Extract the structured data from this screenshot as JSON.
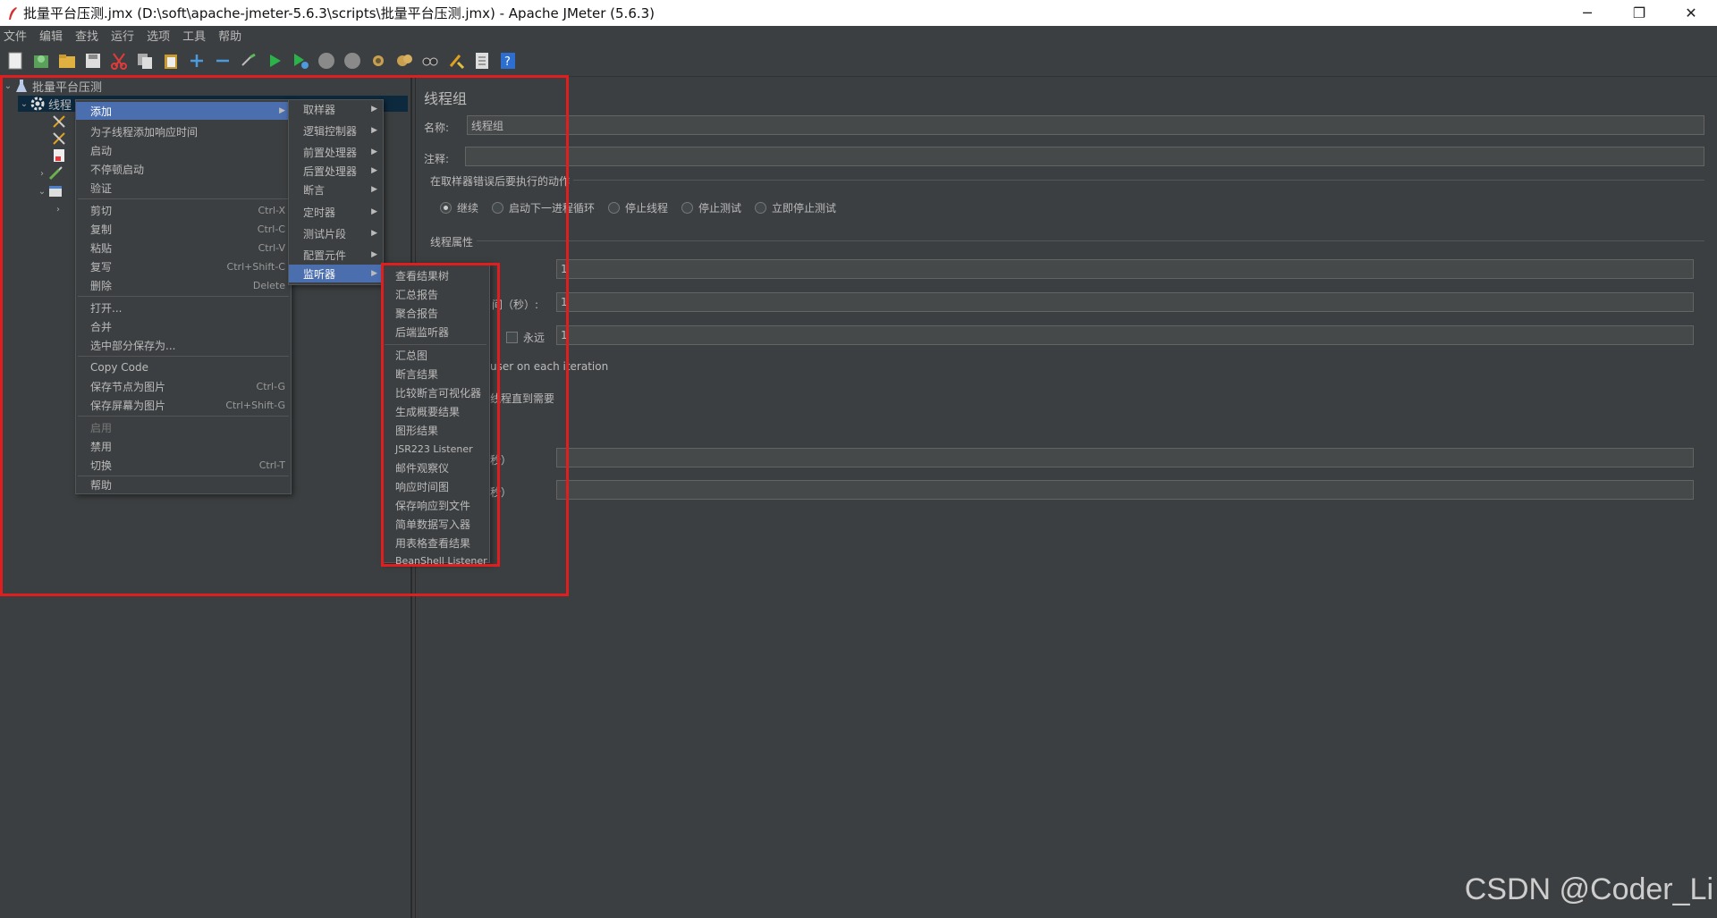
{
  "window": {
    "title": "批量平台压测.jmx (D:\\soft\\apache-jmeter-5.6.3\\scripts\\批量平台压测.jmx) - Apache JMeter (5.6.3)",
    "minimize": "─",
    "restore": "❐",
    "close": "✕"
  },
  "menubar": [
    "文件",
    "编辑",
    "查找",
    "运行",
    "选项",
    "工具",
    "帮助"
  ],
  "tree": {
    "root": "批量平台压测",
    "thread_group": "线程"
  },
  "context_menu": {
    "add": "添加",
    "items": [
      {
        "label": "为子线程添加响应时间",
        "shortcut": ""
      },
      {
        "label": "启动",
        "shortcut": ""
      },
      {
        "label": "不停顿启动",
        "shortcut": ""
      },
      {
        "label": "验证",
        "shortcut": ""
      },
      {
        "label": "剪切",
        "shortcut": "Ctrl-X"
      },
      {
        "label": "复制",
        "shortcut": "Ctrl-C"
      },
      {
        "label": "粘贴",
        "shortcut": "Ctrl-V"
      },
      {
        "label": "复写",
        "shortcut": "Ctrl+Shift-C"
      },
      {
        "label": "删除",
        "shortcut": "Delete"
      },
      {
        "label": "打开...",
        "shortcut": ""
      },
      {
        "label": "合并",
        "shortcut": ""
      },
      {
        "label": "选中部分保存为...",
        "shortcut": ""
      },
      {
        "label": "Copy Code",
        "shortcut": ""
      },
      {
        "label": "保存节点为图片",
        "shortcut": "Ctrl-G"
      },
      {
        "label": "保存屏幕为图片",
        "shortcut": "Ctrl+Shift-G"
      },
      {
        "label": "启用",
        "shortcut": ""
      },
      {
        "label": "禁用",
        "shortcut": ""
      },
      {
        "label": "切换",
        "shortcut": "Ctrl-T"
      },
      {
        "label": "帮助",
        "shortcut": ""
      }
    ]
  },
  "add_submenu": [
    "取样器",
    "逻辑控制器",
    "前置处理器",
    "后置处理器",
    "断言",
    "定时器",
    "测试片段",
    "配置元件",
    "监听器"
  ],
  "listener_submenu": [
    "查看结果树",
    "汇总报告",
    "聚合报告",
    "后端监听器",
    "汇总图",
    "断言结果",
    "比较断言可视化器",
    "生成概要结果",
    "图形结果",
    "JSR223 Listener",
    "邮件观察仪",
    "响应时间图",
    "保存响应到文件",
    "简单数据写入器",
    "用表格查看结果",
    "BeanShell Listener"
  ],
  "thread_group_panel": {
    "title": "线程组",
    "name_label": "名称:",
    "name_value": "线程组",
    "comment_label": "注释:",
    "comment_value": "",
    "error_action_title": "在取样器错误后要执行的动作",
    "error_actions": [
      "继续",
      "启动下一进程循环",
      "停止线程",
      "停止测试",
      "立即停止测试"
    ],
    "thread_props_title": "线程属性",
    "threads_value": "1",
    "ramp_label": "间（秒）:",
    "ramp_value": "1",
    "forever_label": "永远",
    "loop_value": "1",
    "same_user_label": "user on each iteration",
    "delay_label": "线程直到需要",
    "duration_label": "秒）",
    "startup_label": "秒）"
  },
  "watermark": "CSDN @Coder_Li"
}
